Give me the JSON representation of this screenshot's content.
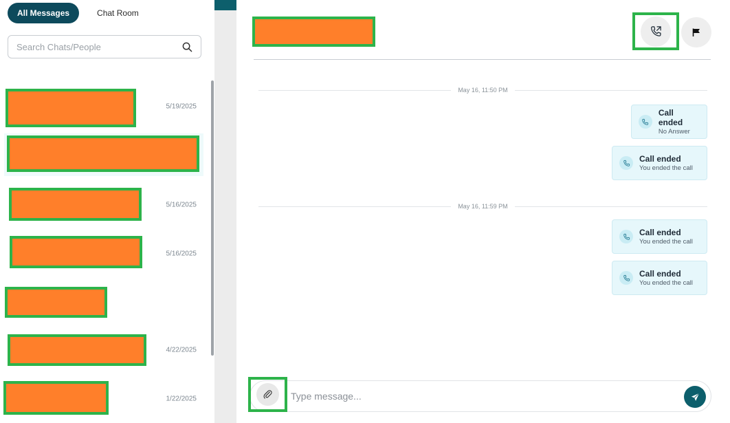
{
  "tabs": {
    "all_messages": "All Messages",
    "chat_room": "Chat Room"
  },
  "search": {
    "placeholder": "Search Chats/People"
  },
  "chats": [
    {
      "date": "5/19/2025"
    },
    {
      "date": ""
    },
    {
      "date": "5/16/2025"
    },
    {
      "date": "5/16/2025"
    },
    {
      "date": ""
    },
    {
      "date": "4/22/2025"
    },
    {
      "date": "1/22/2025"
    }
  ],
  "conversation": {
    "groups": [
      {
        "date_label": "May 16, 11:50 PM",
        "messages": [
          {
            "title": "Call ended",
            "subtitle": "No Answer"
          },
          {
            "title": "Call ended",
            "subtitle": "You ended the call"
          }
        ]
      },
      {
        "date_label": "May 16, 11:59 PM",
        "messages": [
          {
            "title": "Call ended",
            "subtitle": "You ended the call"
          },
          {
            "title": "Call ended",
            "subtitle": "You ended the call"
          }
        ]
      }
    ]
  },
  "composer": {
    "placeholder": "Type message..."
  },
  "colors": {
    "brand": "#0d4a5c",
    "accent": "#0d5f6c",
    "redaction_fill": "#ff7f2a",
    "redaction_border": "#2db34a",
    "bubble": "#e6f7fb"
  },
  "icons": [
    "search-icon",
    "phone-call-icon",
    "flag-icon",
    "phone-icon",
    "paperclip-icon",
    "send-icon"
  ]
}
